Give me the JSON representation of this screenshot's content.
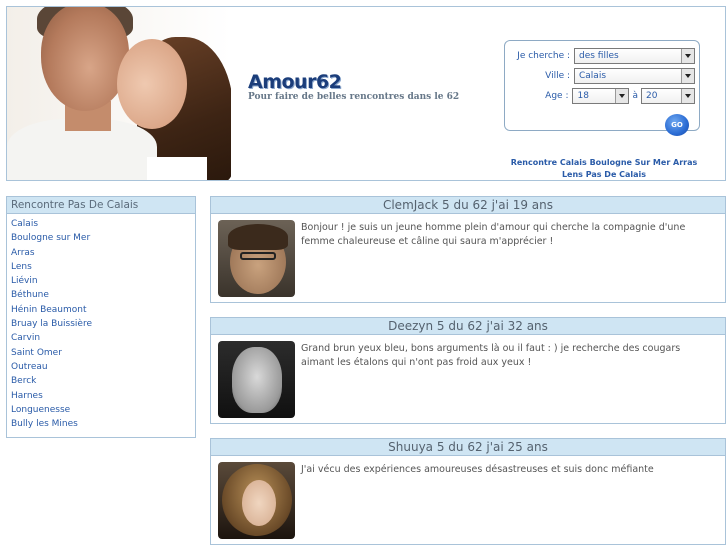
{
  "header": {
    "logo": "Amour62",
    "slogan": "Pour faire de belles rencontres dans le 62",
    "search": {
      "je_cherche_label": "Je cherche :",
      "je_cherche_value": "des filles",
      "ville_label": "Ville :",
      "ville_value": "Calais",
      "age_label": "Age :",
      "age_from": "18",
      "age_sep": "à",
      "age_to": "20",
      "go_label": "GO"
    },
    "link": "Rencontre Calais Boulogne Sur Mer Arras Lens Pas De Calais"
  },
  "sidebar": {
    "title": "Rencontre Pas De Calais",
    "items": [
      "Calais",
      "Boulogne sur Mer",
      "Arras",
      "Lens",
      "Liévin",
      "Béthune",
      "Hénin Beaumont",
      "Bruay la Buissière",
      "Carvin",
      "Saint Omer",
      "Outreau",
      "Berck",
      "Harnes",
      "Longuenesse",
      "Bully les Mines"
    ]
  },
  "profiles": [
    {
      "title": "ClemJack 5 du 62 j'ai 19 ans",
      "text": "Bonjour !  je suis un jeune homme plein d'amour qui cherche la compagnie d'une femme chaleureuse et câline qui saura m'apprécier !"
    },
    {
      "title": "Deezyn 5 du 62 j'ai 32 ans",
      "text": "Grand brun yeux bleu, bons arguments là  ou il faut : )  je recherche des cougars aimant les étalons qui n'ont pas froid aux yeux !"
    },
    {
      "title": "Shuuya 5 du 62 j'ai 25 ans",
      "text": "J'ai vécu des expériences amoureuses désastreuses et suis donc méfiante"
    }
  ]
}
